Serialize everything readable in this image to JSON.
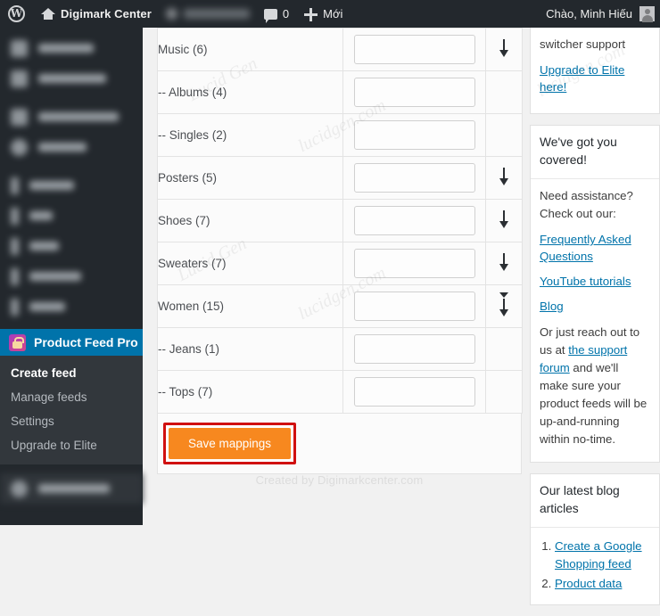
{
  "adminbar": {
    "site_name": "Digimark Center",
    "comment_count": "0",
    "new_label": "Mới",
    "greeting": "Chào, Minh Hiếu",
    "icons": {
      "wp": "wordpress-logo-icon",
      "home": "home-icon",
      "comments": "comment-icon",
      "new": "plus-icon",
      "avatar": "avatar"
    }
  },
  "sidebar": {
    "plugin": {
      "title": "Product Feed Pro",
      "items": [
        {
          "label": "Create feed",
          "current": true
        },
        {
          "label": "Manage feeds",
          "current": false
        },
        {
          "label": "Settings",
          "current": false
        },
        {
          "label": "Upgrade to Elite",
          "current": false
        }
      ]
    },
    "blurred_item_widths": [
      62,
      70,
      85,
      52,
      48,
      26,
      32,
      56,
      40
    ]
  },
  "main": {
    "table": {
      "rows": [
        {
          "category": "Music (6)",
          "value": "",
          "arrow": "down"
        },
        {
          "category": "-- Albums (4)",
          "value": "",
          "arrow": "none"
        },
        {
          "category": "-- Singles (2)",
          "value": "",
          "arrow": "none"
        },
        {
          "category": "Posters (5)",
          "value": "",
          "arrow": "down"
        },
        {
          "category": "Shoes (7)",
          "value": "",
          "arrow": "down"
        },
        {
          "category": "Sweaters (7)",
          "value": "",
          "arrow": "down"
        },
        {
          "category": "Women (15)",
          "value": "",
          "arrow": "caret-down"
        },
        {
          "category": "-- Jeans (1)",
          "value": "",
          "arrow": "none"
        },
        {
          "category": "-- Tops (7)",
          "value": "",
          "arrow": "none"
        }
      ]
    },
    "save_button": "Save mappings",
    "footer_credit": "Created by Digimarkcenter.com"
  },
  "right_sidebar": {
    "upgrade_box": {
      "text": "switcher support",
      "link": "Upgrade to Elite here!"
    },
    "support_box": {
      "heading": "We've got you covered!",
      "intro": "Need assistance? Check out our:",
      "links": [
        "Frequently Asked Questions",
        "YouTube tutorials",
        "Blog"
      ],
      "outro_before": "Or just reach out to us at ",
      "outro_link": "the support forum",
      "outro_after": " and we'll make sure your product feeds will be up-and-running within no-time."
    },
    "blog_box": {
      "heading": "Our latest blog articles",
      "articles": [
        "Create a Google Shopping feed",
        "Product data"
      ]
    }
  },
  "watermarks": [
    "Lucid Gen",
    "lucidgen.com",
    "Lucid Gen",
    "lucidgen.com",
    "Lucid Gen",
    "lucidgen.com"
  ],
  "colors": {
    "adminbar_bg": "#23282d",
    "menu_bg": "#23282d",
    "active_blue": "#0073aa",
    "save_orange": "#f7881f",
    "highlight_red": "#d01010",
    "link_blue": "#0073aa"
  }
}
